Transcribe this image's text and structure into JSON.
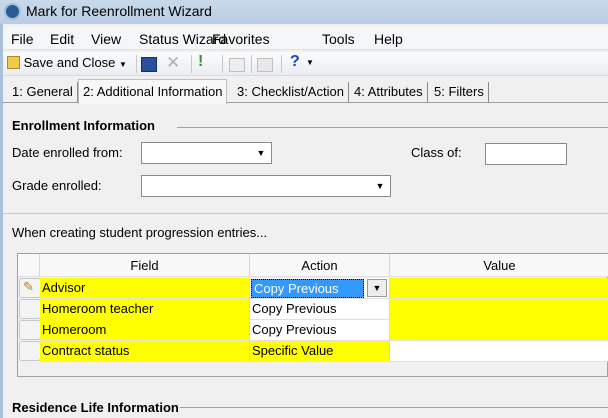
{
  "window": {
    "title": "Mark for Reenrollment Wizard"
  },
  "menu": [
    "File",
    "Edit",
    "View",
    "Status Wizard",
    "Favorites",
    "Tools",
    "Help"
  ],
  "toolbar": {
    "save_close": "Save and Close",
    "help": "?"
  },
  "tabs": [
    "1: General",
    "2: Additional Information",
    "3: Checklist/Action",
    "4: Attributes",
    "5: Filters"
  ],
  "enrollment": {
    "heading": "Enrollment Information",
    "date_label": "Date enrolled from:",
    "date_value": "",
    "class_label": "Class of:",
    "class_value": "",
    "grade_label": "Grade enrolled:",
    "grade_value": ""
  },
  "progression": {
    "intro": "When creating student progression entries...",
    "columns": [
      "Field",
      "Action",
      "Value"
    ],
    "rows": [
      {
        "field": "Advisor",
        "action": "Copy Previous",
        "value": ""
      },
      {
        "field": "Homeroom teacher",
        "action": "Copy Previous",
        "value": ""
      },
      {
        "field": "Homeroom",
        "action": "Copy Previous",
        "value": ""
      },
      {
        "field": "Contract status",
        "action": "Specific Value",
        "value": ""
      }
    ]
  },
  "residence": {
    "heading": "Residence Life Information"
  },
  "colors": {
    "highlight": "#ffff00",
    "selection": "#3399ff"
  }
}
